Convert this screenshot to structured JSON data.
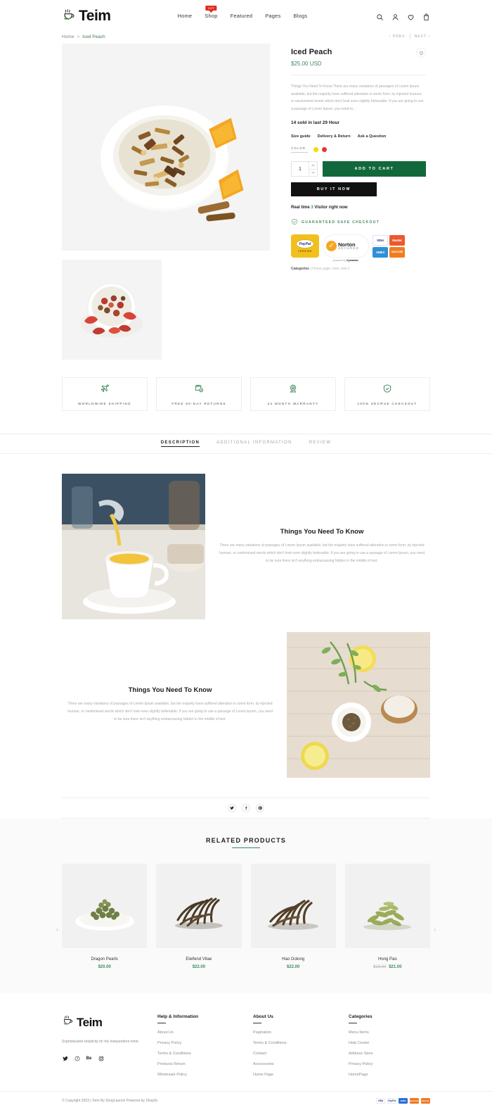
{
  "header": {
    "brand": "Teim",
    "nav": [
      {
        "label": "Home",
        "badge": null
      },
      {
        "label": "Shop",
        "badge": "HOT"
      },
      {
        "label": "Featured",
        "badge": null
      },
      {
        "label": "Pages",
        "badge": null
      },
      {
        "label": "Blogs",
        "badge": null
      }
    ],
    "icons": [
      "search-icon",
      "account-icon",
      "wishlist-icon",
      "cart-icon"
    ]
  },
  "breadcrumb": {
    "home": "Home",
    "separator": ">",
    "current": "Iced Peach",
    "prev": "PREV",
    "next": "NEXT"
  },
  "product": {
    "title": "Iced Peach",
    "price": "$25.00 USD",
    "description": "Things You Need To Know There are many variations of passages of Lorem Ipsum available, but the majority have suffered alteration in some form, by injected humour, or randomised words which don't look even slightly believable. If you are going to use a passage of Lorem Ipsum, you need to...",
    "sold_line": "14 sold in last 29 Hour",
    "meta_links": [
      "Size guide",
      "Delivery & Return",
      "Ask a Question"
    ],
    "color_label": "COLOR",
    "swatches": [
      "#f5d90a",
      "#e8342a"
    ],
    "quantity": "1",
    "add_to_cart": "ADD TO CART",
    "buy_now": "BUY IT NOW",
    "visitor_text_pre": "Real time",
    "visitor_count": "3",
    "visitor_text_post": "Visitor right now",
    "safe_checkout": "GUARANTEED SAFE CHECKOUT",
    "categories_label": "Categories :",
    "categories_value": "Home page, new, new 1",
    "badges": {
      "paypal_main": "PayPal",
      "paypal_sub": "VERIFIED",
      "norton_name": "Norton",
      "norton_sub": "SECURED",
      "norton_by_pre": "powered by",
      "norton_by": "Symantec",
      "cards": [
        {
          "name": "VISA",
          "color": "#1a1f71",
          "bg": "#ffffff"
        },
        {
          "name": "Master",
          "color": "#ffffff",
          "bg": "#eb5a2e"
        },
        {
          "name": "AMEX",
          "color": "#ffffff",
          "bg": "#2e8fd6"
        },
        {
          "name": "DISCOVER",
          "color": "#ffffff",
          "bg": "#f07d20"
        }
      ]
    },
    "colors": {
      "accent_green": "#3d8b5f",
      "cart_green": "#11693b",
      "buy_black": "#111111"
    }
  },
  "features": [
    {
      "icon": "airplane-icon",
      "label": "WORLDWIDE SHIPPING"
    },
    {
      "icon": "return-box-icon",
      "label": "FREE 60-DAY RETURNS"
    },
    {
      "icon": "award-icon",
      "label": "24 MONTH WARRANTY"
    },
    {
      "icon": "shield-check-icon",
      "label": "100% SECRUE CHECKOUT"
    }
  ],
  "tabs": [
    {
      "label": "DESCRIPTION",
      "active": true
    },
    {
      "label": "ADDITIONAL INFORMATION",
      "active": false
    },
    {
      "label": "REVIEW",
      "active": false
    }
  ],
  "description_blocks": [
    {
      "heading": "Things You Need To Know",
      "body": "There are many variations of passages of Lorem Ipsum available, but the majority have suffered alteration in some form, by injected humour, or randomised words which don't look even slightly believable. If you are going to use a passage of Lorem Ipsum, you need to be sure there isn't anything embarrassing hidden in the middle of text."
    },
    {
      "heading": "Things You Need To Know",
      "body": "There are many variations of passages of Lorem Ipsum available, but the majority have suffered alteration in some form, by injected humour, or randomised words which don't look even slightly believable. If you are going to use a passage of Lorem Ipsum, you need to be sure there isn't anything embarrassing hidden in the middle of text."
    }
  ],
  "share": [
    "twitter-icon",
    "facebook-icon",
    "pinterest-icon"
  ],
  "related": {
    "heading": "RELATED PRODUCTS",
    "prev_arrow": "‹",
    "next_arrow": "›",
    "products": [
      {
        "name": "Dragon Pearls",
        "price": "$20.00",
        "old_price": null
      },
      {
        "name": "Eleifend Vitae",
        "price": "$22.00",
        "old_price": null
      },
      {
        "name": "Hao Oolong",
        "price": "$22.00",
        "old_price": null
      },
      {
        "name": "Hong Pao",
        "price": "$21.00",
        "old_price": "$23.00"
      }
    ]
  },
  "footer": {
    "brand": "Teim",
    "tagline": "Sophisticated simplicity for the independent mind.",
    "social": [
      "twitter-icon",
      "pinterest-icon",
      "behance-icon",
      "instagram-icon"
    ],
    "columns": [
      {
        "heading": "Help & Information",
        "links": [
          "About Us",
          "Privacy Policy",
          "Terms & Conditions",
          "Products Return",
          "Wholesale Policy"
        ]
      },
      {
        "heading": "About Us",
        "links": [
          "Pagination",
          "Terms & Conditions",
          "Contact",
          "Accessories",
          "Home Page"
        ]
      },
      {
        "heading": "Categories",
        "links": [
          "Menu Items",
          "Help Center",
          "Address Store",
          "Privacy Policy",
          "HomePage"
        ]
      }
    ],
    "copyright": "© Copyright 2023 | Teim By ShopLaunch  Powered by Shopify",
    "payment_icons": [
      "VISA",
      "PayPal",
      "AMEX",
      "MasterCard",
      "Discover"
    ]
  }
}
